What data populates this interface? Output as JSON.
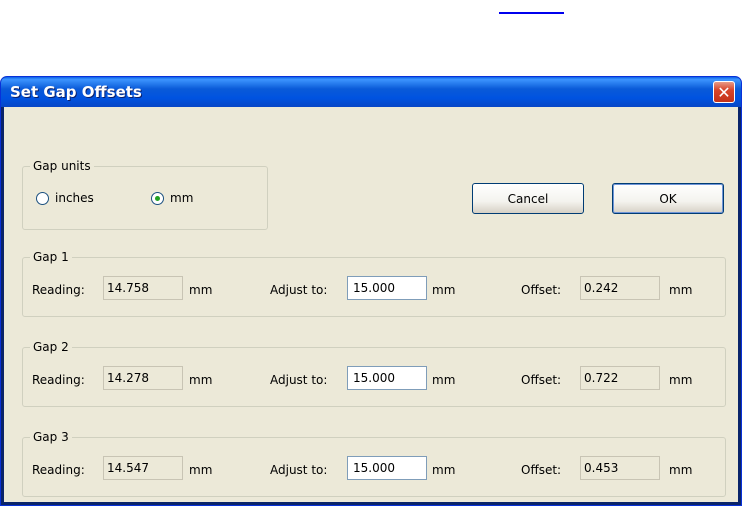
{
  "dialog": {
    "title": "Set Gap Offsets",
    "close_glyph": "✕"
  },
  "units": {
    "legend": "Gap units",
    "options": [
      {
        "label": "inches",
        "selected": false
      },
      {
        "label": "mm",
        "selected": true
      }
    ]
  },
  "buttons": {
    "cancel": "Cancel",
    "ok": "OK"
  },
  "labels": {
    "reading": "Reading:",
    "adjust": "Adjust to:",
    "offset": "Offset:",
    "unit": "mm"
  },
  "gaps": [
    {
      "legend": "Gap 1",
      "reading": "14.758",
      "adjust": "15.000",
      "offset": "0.242"
    },
    {
      "legend": "Gap 2",
      "reading": "14.278",
      "adjust": "15.000",
      "offset": "0.722"
    },
    {
      "legend": "Gap 3",
      "reading": "14.547",
      "adjust": "15.000",
      "offset": "0.453"
    }
  ],
  "colors": {
    "title_bar": "#0053e0",
    "dialog_bg": "#ece9d8",
    "close_button": "#d8452a",
    "selected_radio": "#21a121"
  }
}
